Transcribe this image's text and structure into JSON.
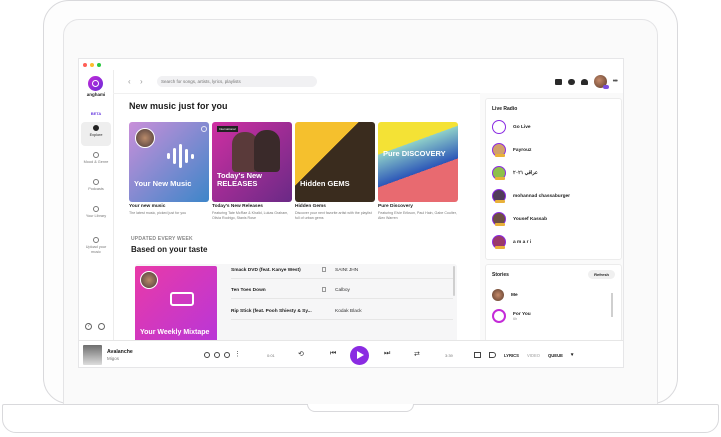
{
  "app": {
    "name": "anghami",
    "beta": "BETA"
  },
  "sidebar": {
    "items": [
      {
        "label": "Explore",
        "active": true
      },
      {
        "label": "Mood & Genre"
      },
      {
        "label": "Podcasts"
      },
      {
        "label": "Your Library"
      },
      {
        "label": "Upload your music"
      }
    ]
  },
  "search": {
    "placeholder": "Search for songs, artists, lyrics, playlists"
  },
  "main": {
    "title": "New music just for you",
    "cards": [
      {
        "art_text": "Your New Music",
        "title": "Your new music",
        "desc": "The latest music, picked just for you",
        "gradient": "#c98fd9,#3d86c9"
      },
      {
        "art_text": "Today's New RELEASES",
        "title": "Today's New Releases",
        "desc": "Featuring Tate McRae & Khalid, Lukas Graham, Olivia Rodrigo, Stanis Rose",
        "gradient": "#cf2fa2,#6a2a86",
        "tag": "International"
      },
      {
        "art_text": "Hidden GEMS",
        "title": "Hidden Gems",
        "desc": "Discover your next favorite artist with the playlist full of urban gems",
        "gradient": "#f2b72a,#3a2c1e"
      },
      {
        "art_text": "Pure DISCOVERY",
        "title": "Pure Discovery",
        "desc": "Featuring Elvie Erikson, Paul Hain, Gabe Coulter, Alex Warren",
        "gradient": "#f4e235,#2c56b8"
      }
    ],
    "updated_label": "UPDATED EVERY WEEK",
    "section_title": "Based on your taste",
    "mixtape_text": "Your Weekly Mixtape",
    "tracks": [
      {
        "name": "Smack DVD (feat. Kanye West)",
        "artist": "SAINt JHN"
      },
      {
        "name": "Ten Toes Down",
        "artist": "Calboy"
      },
      {
        "name": "Rip Stick (feat. Pooh Shiesty & Sy...",
        "artist": "Kodak Black"
      }
    ]
  },
  "live_radio": {
    "title": "Live Radio",
    "items": [
      {
        "name": "Go Live",
        "color": "#ffffff"
      },
      {
        "name": "Fayrouz",
        "color": "#d2a06a"
      },
      {
        "name": "عراقي ٢٠٢١",
        "color": "#8ec04a"
      },
      {
        "name": "mohannad chassaburger",
        "color": "#503c5a"
      },
      {
        "name": "Yousef Kassab",
        "color": "#6d4f43"
      },
      {
        "name": "a m a r i",
        "color": "#9a3a6a"
      }
    ],
    "live_tag": "LIVE"
  },
  "stories": {
    "title": "Stories",
    "refresh": "Refresh",
    "items": [
      {
        "name": "Me",
        "sub": ""
      },
      {
        "name": "For You",
        "sub": "6h"
      }
    ]
  },
  "player": {
    "title": "Avalanche",
    "artist": "Migos",
    "current_time": "0:01",
    "total_time": "3:39",
    "lyrics": "LYRICS",
    "video": "VIDEO",
    "queue": "QUEUE"
  },
  "colors": {
    "accent": "#8a2be2",
    "brand_gradient": "#c42bd8"
  }
}
